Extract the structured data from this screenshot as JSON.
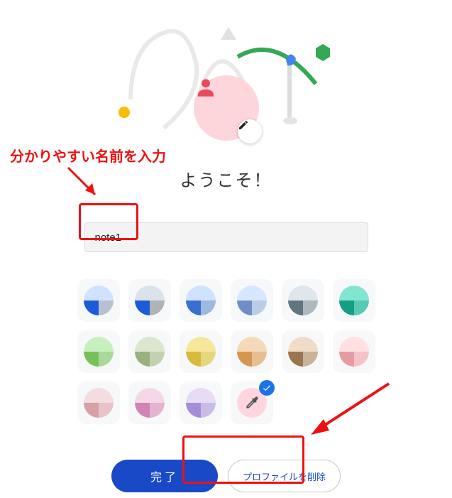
{
  "annotation": {
    "label": "分かりやすい名前を入力"
  },
  "welcome": "ようこそ！",
  "name_input": {
    "value": "note1"
  },
  "colors": [
    {
      "top": "#cfe2ff",
      "bl": "#1d5bd6",
      "br": "#b9c1d0"
    },
    {
      "top": "#dbe2ea",
      "bl": "#1d5bd6",
      "br": "#aeb3b8"
    },
    {
      "top": "#cfe2ff",
      "bl": "#3a6fd1",
      "br": "#9fb8e0"
    },
    {
      "top": "#d8e7ff",
      "bl": "#6f8fc4",
      "br": "#bacde6"
    },
    {
      "top": "#dfe6ec",
      "bl": "#62747f",
      "br": "#aeb8bf"
    },
    {
      "top": "#81e6d0",
      "bl": "#159e86",
      "br": "#58c9b2"
    },
    {
      "top": "#c8f0bf",
      "bl": "#76c25a",
      "br": "#a8d89a"
    },
    {
      "top": "#dce5ce",
      "bl": "#9ab07f",
      "br": "#c3d1b0"
    },
    {
      "top": "#f6e79c",
      "bl": "#d8bb3b",
      "br": "#e6d680"
    },
    {
      "top": "#f6d9b8",
      "bl": "#d49650",
      "br": "#e6be92"
    },
    {
      "top": "#f0dcc9",
      "bl": "#9b7452",
      "br": "#cbb39a"
    },
    {
      "top": "#ffe0e3",
      "bl": "#e69aa2",
      "br": "#f4c3c8"
    },
    {
      "top": "#f4dde0",
      "bl": "#d6a0a6",
      "br": "#e8c4c8"
    },
    {
      "top": "#f4d8e8",
      "bl": "#d084b5",
      "br": "#e4b3d0"
    },
    {
      "top": "#e6dcf5",
      "bl": "#a58ed6",
      "br": "#c9bde8"
    }
  ],
  "custom_selected": true,
  "buttons": {
    "done": "完了",
    "delete_profile": "プロファイルを削除"
  }
}
